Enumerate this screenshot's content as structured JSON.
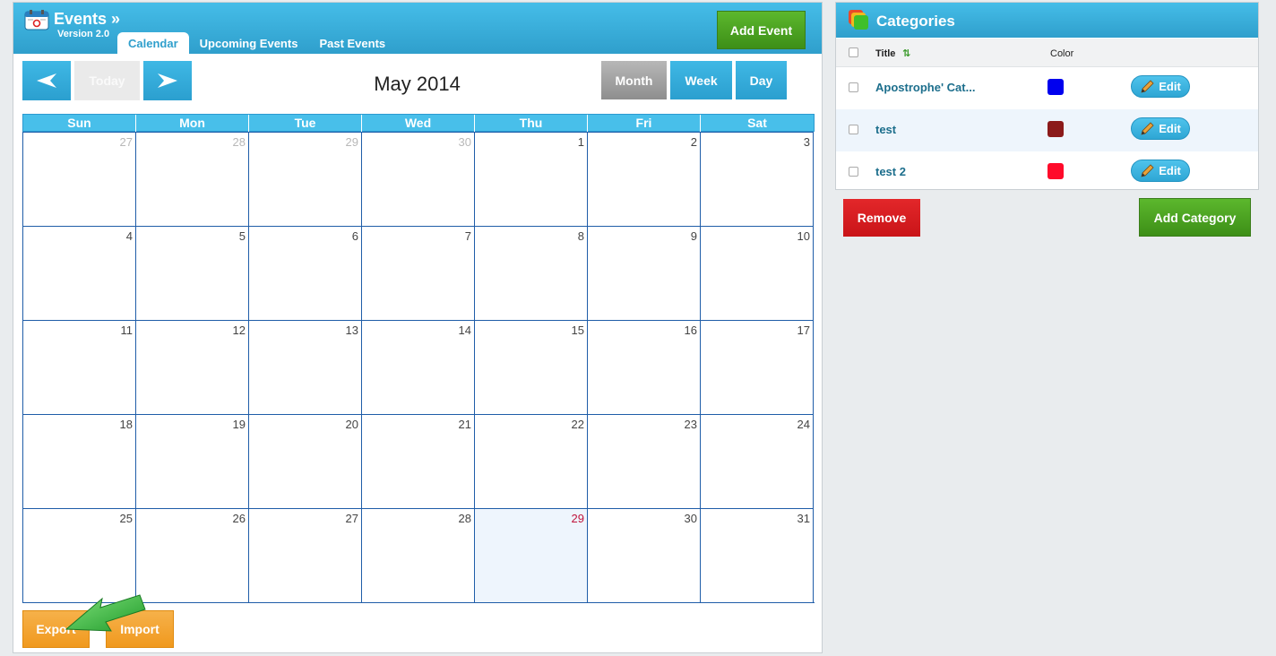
{
  "header": {
    "title": "Events »",
    "version": "Version 2.0",
    "tabs": [
      {
        "label": "Calendar",
        "active": true
      },
      {
        "label": "Upcoming Events",
        "active": false
      },
      {
        "label": "Past Events",
        "active": false
      }
    ],
    "add_event_label": "Add Event"
  },
  "toolbar": {
    "prev_icon": "left-arrow-icon",
    "today_label": "Today",
    "next_icon": "right-arrow-icon",
    "month_title": "May 2014",
    "view_month": "Month",
    "view_week": "Week",
    "view_day": "Day",
    "active_view": "Month"
  },
  "calendar": {
    "weekdays": [
      "Sun",
      "Mon",
      "Tue",
      "Wed",
      "Thu",
      "Fri",
      "Sat"
    ],
    "weeks": [
      [
        "27",
        "28",
        "29",
        "30",
        "1",
        "2",
        "3"
      ],
      [
        "4",
        "5",
        "6",
        "7",
        "8",
        "9",
        "10"
      ],
      [
        "11",
        "12",
        "13",
        "14",
        "15",
        "16",
        "17"
      ],
      [
        "18",
        "19",
        "20",
        "21",
        "22",
        "23",
        "24"
      ],
      [
        "25",
        "26",
        "27",
        "28",
        "29",
        "30",
        "31"
      ]
    ],
    "today": "29"
  },
  "footer": {
    "export_label": "Export",
    "import_label": "Import"
  },
  "categories": {
    "title": "Categories",
    "col_title": "Title",
    "col_color": "Color",
    "rows": [
      {
        "title": "Apostrophe' Cat...",
        "color": "#0000ee",
        "edit_label": "Edit"
      },
      {
        "title": "test",
        "color": "#8b1a1a",
        "edit_label": "Edit"
      },
      {
        "title": "test 2",
        "color": "#ff0a2a",
        "edit_label": "Edit"
      }
    ],
    "remove_label": "Remove",
    "add_label": "Add Category"
  },
  "colors": {
    "accent": "#3fb8e5",
    "today_highlight": "#eef5fd",
    "today_number": "#c0143c"
  }
}
